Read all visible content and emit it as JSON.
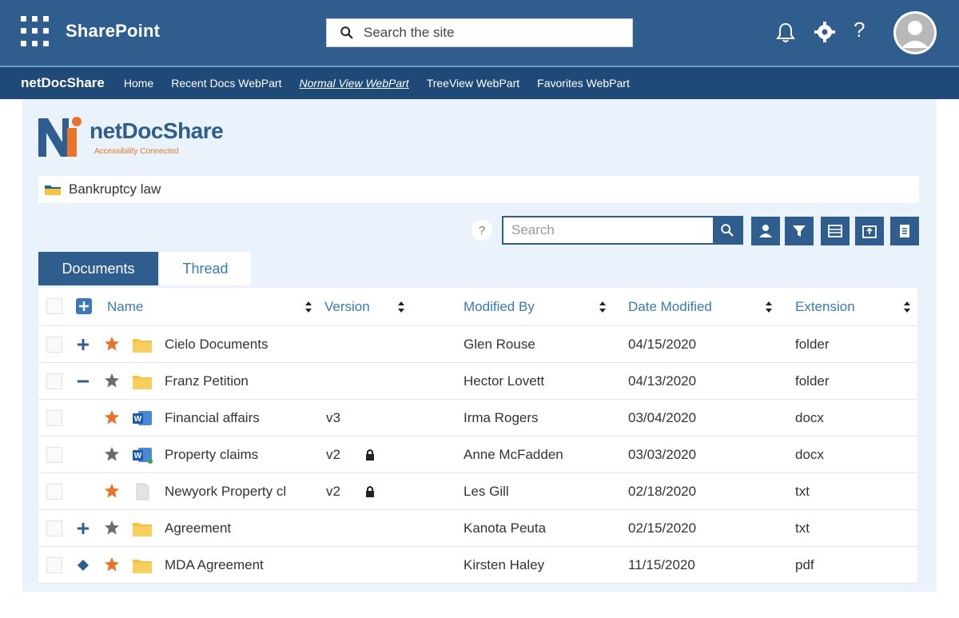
{
  "suite": {
    "app_name": "SharePoint",
    "search_placeholder": "Search the site",
    "help_label": "?"
  },
  "sitenav": {
    "site_name": "netDocShare",
    "links": [
      "Home",
      "Recent Docs WebPart",
      "Normal View WebPart",
      "TreeView WebPart",
      "Favorites WebPart"
    ],
    "active_index": 2
  },
  "logo": {
    "text": "netDocShare",
    "tagline": "Accessibility Connected"
  },
  "breadcrumb": {
    "text": "Bankruptcy law"
  },
  "toolbar": {
    "help": "?",
    "search_placeholder": "Search"
  },
  "tabs": [
    {
      "label": "Documents",
      "active": true
    },
    {
      "label": "Thread",
      "active": false
    }
  ],
  "columns": {
    "name": "Name",
    "version": "Version",
    "modified_by": "Modified By",
    "date_modified": "Date Modified",
    "extension": "Extension"
  },
  "rows": [
    {
      "expander": "plus",
      "star": "orange",
      "icon": "folder",
      "name": "Cielo Documents",
      "version": "",
      "locked": false,
      "modified_by": "Glen Rouse",
      "date": "04/15/2020",
      "extension": "folder"
    },
    {
      "expander": "minus",
      "star": "gray",
      "icon": "folder",
      "name": "Franz Petition",
      "version": "",
      "locked": false,
      "modified_by": "Hector Lovett",
      "date": "04/13/2020",
      "extension": "folder"
    },
    {
      "expander": "none",
      "star": "orange",
      "icon": "word",
      "name": "Financial affairs",
      "version": "v3",
      "locked": false,
      "modified_by": "Irma Rogers",
      "date": "03/04/2020",
      "extension": "docx"
    },
    {
      "expander": "none",
      "star": "gray",
      "icon": "word-synced",
      "name": "Property claims",
      "version": "v2",
      "locked": true,
      "modified_by": "Anne McFadden",
      "date": "03/03/2020",
      "extension": "docx"
    },
    {
      "expander": "none",
      "star": "orange",
      "icon": "text",
      "name": "Newyork Property cl",
      "version": "v2",
      "locked": true,
      "modified_by": "Les Gill",
      "date": "02/18/2020",
      "extension": "txt"
    },
    {
      "expander": "plus",
      "star": "gray",
      "icon": "folder",
      "name": "Agreement",
      "version": "",
      "locked": false,
      "modified_by": "Kanota Peuta",
      "date": "02/15/2020",
      "extension": "txt"
    },
    {
      "expander": "diamond",
      "star": "orange",
      "icon": "folder",
      "name": "MDA Agreement",
      "version": "",
      "locked": false,
      "modified_by": "Kirsten Haley",
      "date": "11/15/2020",
      "extension": "pdf"
    }
  ],
  "colors": {
    "suite_bar": "#2e5d8e",
    "site_nav": "#1f4a78",
    "accent": "#2e5d8e",
    "link": "#3a79b8",
    "star_orange": "#e8732a",
    "star_gray": "#6b6b6b",
    "folder": "#f5c342"
  }
}
